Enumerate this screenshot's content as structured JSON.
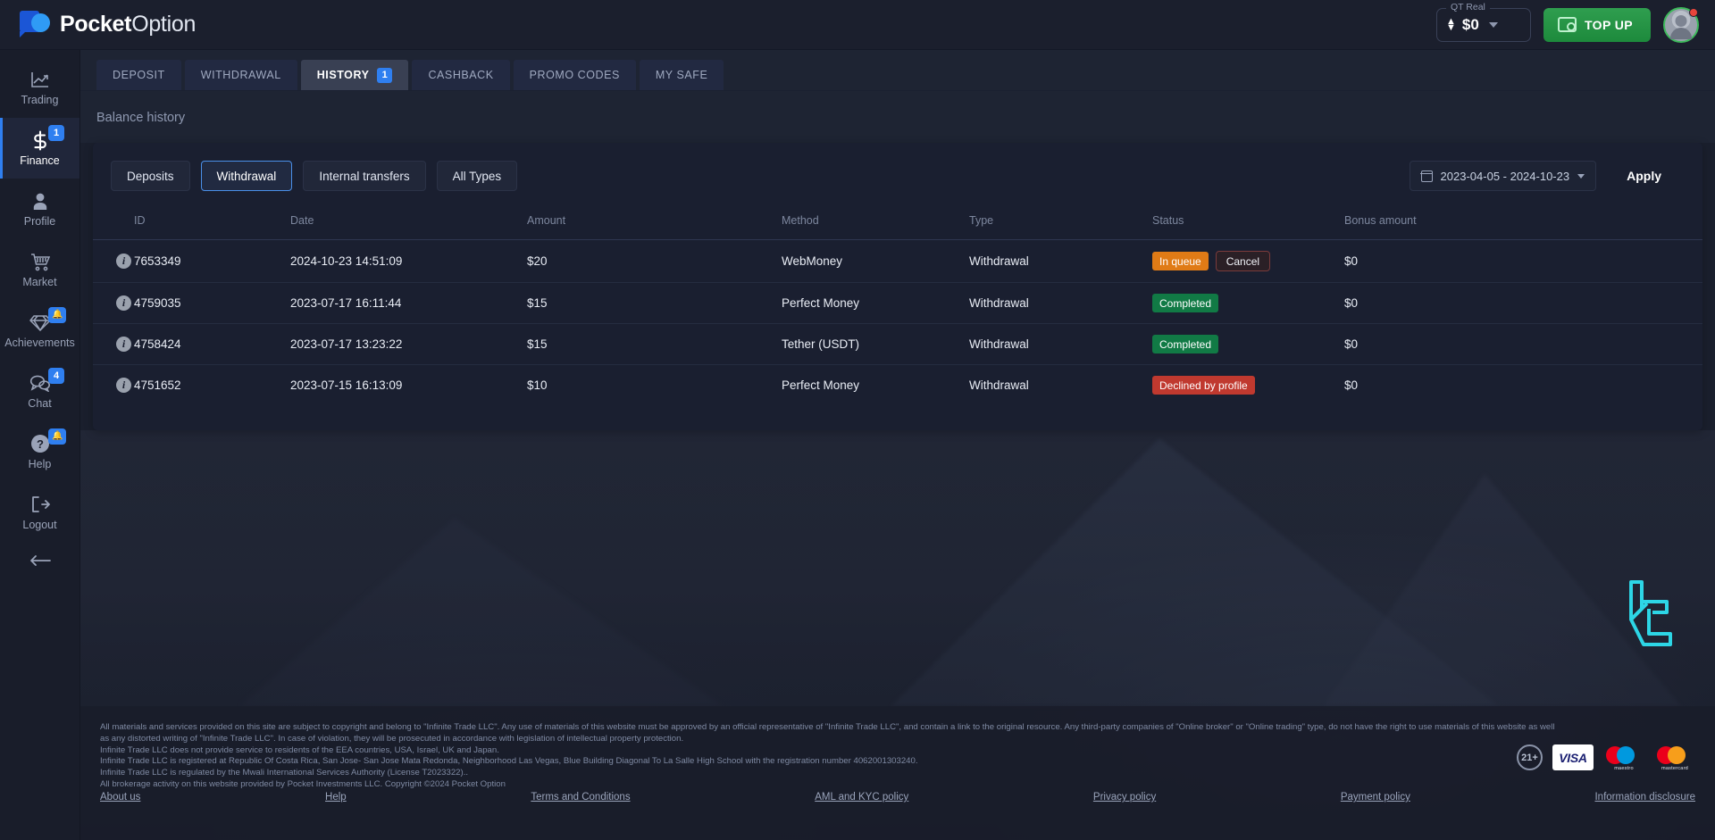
{
  "brand": {
    "name_bold": "Pocket",
    "name_light": "Option"
  },
  "topbar": {
    "balance_label": "QT Real",
    "balance_amount": "$0",
    "topup_label": "TOP UP"
  },
  "sidebar": {
    "items": [
      {
        "label": "Trading",
        "icon": "chart-line-icon",
        "badge": "",
        "active": false
      },
      {
        "label": "Finance",
        "icon": "dollar-icon",
        "badge": "1",
        "active": true
      },
      {
        "label": "Profile",
        "icon": "user-icon",
        "badge": "",
        "active": false
      },
      {
        "label": "Market",
        "icon": "cart-icon",
        "badge": "",
        "active": false
      },
      {
        "label": "Achievements",
        "icon": "diamond-icon",
        "badge": "bell",
        "active": false
      },
      {
        "label": "Chat",
        "icon": "chat-icon",
        "badge": "4",
        "active": false
      },
      {
        "label": "Help",
        "icon": "question-icon",
        "badge": "bell",
        "active": false
      },
      {
        "label": "Logout",
        "icon": "logout-icon",
        "badge": "",
        "active": false
      }
    ],
    "collapse_icon": "arrow-left-icon"
  },
  "tabs": [
    {
      "label": "DEPOSIT",
      "badge": "",
      "active": false
    },
    {
      "label": "WITHDRAWAL",
      "badge": "",
      "active": false
    },
    {
      "label": "HISTORY",
      "badge": "1",
      "active": true
    },
    {
      "label": "CASHBACK",
      "badge": "",
      "active": false
    },
    {
      "label": "PROMO CODES",
      "badge": "",
      "active": false
    },
    {
      "label": "MY SAFE",
      "badge": "",
      "active": false
    }
  ],
  "page": {
    "title": "Balance history"
  },
  "filters": {
    "chips": [
      {
        "label": "Deposits",
        "selected": false
      },
      {
        "label": "Withdrawal",
        "selected": true
      },
      {
        "label": "Internal transfers",
        "selected": false
      },
      {
        "label": "All Types",
        "selected": false
      }
    ],
    "date_range": "2023-04-05 - 2024-10-23",
    "apply_label": "Apply"
  },
  "table": {
    "columns": [
      "ID",
      "Date",
      "Amount",
      "Method",
      "Type",
      "Status",
      "Bonus amount"
    ],
    "rows": [
      {
        "id": "7653349",
        "date": "2024-10-23 14:51:09",
        "amount": "$20",
        "method": "WebMoney",
        "type": "Withdrawal",
        "status": "In queue",
        "status_kind": "queue",
        "cancel_label": "Cancel",
        "bonus": "$0"
      },
      {
        "id": "4759035",
        "date": "2023-07-17 16:11:44",
        "amount": "$15",
        "method": "Perfect Money",
        "type": "Withdrawal",
        "status": "Completed",
        "status_kind": "completed",
        "cancel_label": "",
        "bonus": "$0"
      },
      {
        "id": "4758424",
        "date": "2023-07-17 13:23:22",
        "amount": "$15",
        "method": "Tether (USDT)",
        "type": "Withdrawal",
        "status": "Completed",
        "status_kind": "completed",
        "cancel_label": "",
        "bonus": "$0"
      },
      {
        "id": "4751652",
        "date": "2023-07-15 16:13:09",
        "amount": "$10",
        "method": "Perfect Money",
        "type": "Withdrawal",
        "status": "Declined by profile",
        "status_kind": "declined",
        "cancel_label": "",
        "bonus": "$0"
      }
    ]
  },
  "footer": {
    "legal": [
      "All materials and services provided on this site are subject to copyright and belong to \"Infinite Trade LLC\". Any use of materials of this website must be approved by an official representative of \"Infinite Trade LLC\", and contain a link to the original resource. Any third-party companies of \"Online broker\" or \"Online trading\" type, do not have the right to use materials of this website as well",
      "as any distorted writing of \"Infinite Trade LLC\". In case of violation, they will be prosecuted in accordance with legislation of intellectual property protection.",
      "Infinite Trade LLC does not provide service to residents of the EEA countries, USA, Israel, UK and Japan.",
      "Infinite Trade LLC is registered at Republic Of Costa Rica, San Jose- San Jose Mata Redonda, Neighborhood Las Vegas, Blue Building Diagonal To La Salle High School with the registration number 4062001303240.",
      "Infinite Trade LLC is regulated by the Mwali International Services Authority (License T2023322)..",
      "All brokerage activity on this website provided by Pocket Investments LLC. Copyright ©2024 Pocket Option"
    ],
    "links": [
      "About us",
      "Help",
      "Terms and Conditions",
      "AML and KYC policy",
      "Privacy policy",
      "Payment policy",
      "Information disclosure"
    ],
    "badges": {
      "age": "21+",
      "visa": "VISA",
      "maestro": "maestro",
      "mastercard": "mastercard"
    }
  },
  "watermark": {
    "color": "#2ee0f0"
  }
}
